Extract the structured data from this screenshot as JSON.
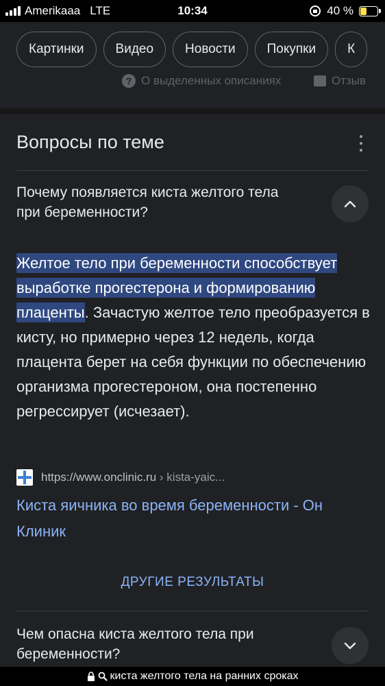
{
  "status_bar": {
    "carrier": "Amerikaaa",
    "network": "LTE",
    "time": "10:34",
    "battery": "40 %",
    "battery_level": 0.4
  },
  "chips": [
    "Картинки",
    "Видео",
    "Новости",
    "Покупки",
    "К"
  ],
  "partial_row": {
    "about_label": "О выделенных описаниях",
    "feedback_label": "Отзыв"
  },
  "section": {
    "title": "Вопросы по теме"
  },
  "q1": {
    "question": "Почему появляется киста желтого тела при беременности?",
    "answer_highlight": "Желтое тело при беременности способствует выработке прогестерона и формированию плаценты",
    "answer_rest": ". Зачастую желтое тело преобразуется в кисту, но примерно через 12 недель, когда плацента берет на себя функции по обеспечению организма прогестероном, она постепенно регрессирует (исчезает).",
    "source_url": "https://www.onclinic.ru",
    "source_crumb": " › kista-yaic...",
    "link_title": "Киста яичника во время беременности - Он Клиник"
  },
  "more_results": "ДРУГИЕ РЕЗУЛЬТАТЫ",
  "q2": {
    "question": "Чем опасна киста желтого тела при беременности?"
  },
  "url_bar": {
    "text": "киста желтого тела на ранних сроках"
  },
  "colors": {
    "background": "#202124",
    "link": "#8ab4f8",
    "highlight": "#2f4880",
    "battery": "#ffe14a"
  }
}
